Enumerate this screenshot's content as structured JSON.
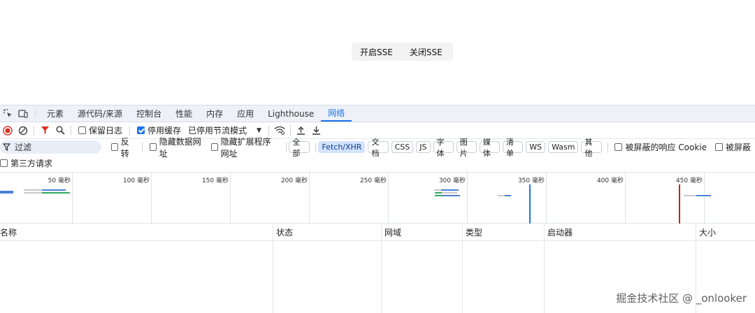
{
  "page": {
    "buttons": {
      "open_sse": "开启SSE",
      "close_sse": "关闭SSE"
    }
  },
  "devtools": {
    "tabs": [
      {
        "label": "元素"
      },
      {
        "label": "源代码/来源"
      },
      {
        "label": "控制台"
      },
      {
        "label": "性能"
      },
      {
        "label": "内存"
      },
      {
        "label": "应用"
      },
      {
        "label": "Lighthouse"
      },
      {
        "label": "网络",
        "active": true
      }
    ],
    "toolbar": {
      "preserve_log": "保留日志",
      "disable_cache": "停用缓存",
      "throttle": "已停用节流模式"
    },
    "filter": {
      "placeholder": "过滤",
      "invert": "反转",
      "hide_data_urls": "隐藏数据网址",
      "hide_ext_urls": "隐藏扩展程序网址",
      "types": [
        "全部",
        "Fetch/XHR",
        "文档",
        "CSS",
        "JS",
        "字体",
        "图片",
        "媒体",
        "清单",
        "WS",
        "Wasm",
        "其他"
      ],
      "selected_type": "Fetch/XHR",
      "blocked_cookies": "被屏蔽的响应 Cookie",
      "blocked_requests": "被屏蔽",
      "third_party": "第三方请求"
    },
    "overview": {
      "ticks": [
        "50 毫秒",
        "100 毫秒",
        "150 毫秒",
        "200 毫秒",
        "250 毫秒",
        "300 毫秒",
        "350 毫秒",
        "400 毫秒",
        "450 毫秒"
      ]
    },
    "columns": [
      "名称",
      "状态",
      "网域",
      "类型",
      "启动器",
      "大小"
    ],
    "colors": {
      "accent": "#1a73e8",
      "record": "#d93025",
      "dom_line": "#1a73e8",
      "load_line": "#c5221f"
    }
  },
  "watermark": "掘金技术社区 @ _onlooker"
}
